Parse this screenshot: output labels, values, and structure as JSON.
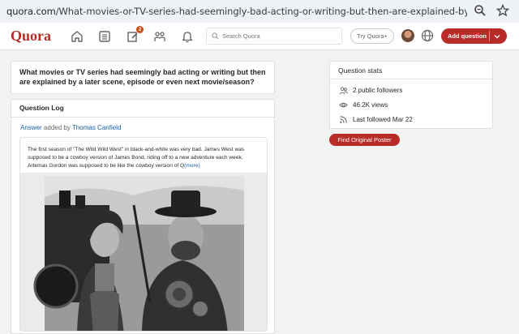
{
  "browser": {
    "url_domain": "quora.com",
    "url_path": "/What-movies-or-TV-series-had-seemingly-bad-acting-or-writing-but-then-are-explained-by-a-later-scene-episode-...",
    "icons": [
      "zoom-icon",
      "star-icon"
    ]
  },
  "header": {
    "logo": "Quora",
    "nav": [
      "home-icon",
      "following-icon",
      "answer-icon",
      "spaces-icon",
      "notifications-icon"
    ],
    "answer_badge": "2",
    "search_placeholder": "Search Quora",
    "try_label": "Try Quora+",
    "add_question_label": "Add question"
  },
  "question": {
    "title": "What movies or TV series had seemingly bad acting or writing but then are explained by a later scene, episode or even next movie/season?"
  },
  "question_log": {
    "heading": "Question Log",
    "answer_link": "Answer",
    "added_by": "added by",
    "author": "Thomas Canfield",
    "answer_text": "The first season of \"The Wild Wild West\" in black-and-white was very bad. James West was supposed to be a cowboy version of James Bond, riding off to a new adventure each week. Artemas Gordon was supposed to be like the cowboy version of Q",
    "more_label": "(more)"
  },
  "stats": {
    "heading": "Question stats",
    "followers": "2 public followers",
    "views": "46.2K views",
    "last_followed": "Last followed Mar 22"
  },
  "find_poster_label": "Find Original Poster",
  "colors": {
    "brand_red": "#b92b27",
    "link_blue": "#195faa",
    "background": "#f1f2f2"
  }
}
